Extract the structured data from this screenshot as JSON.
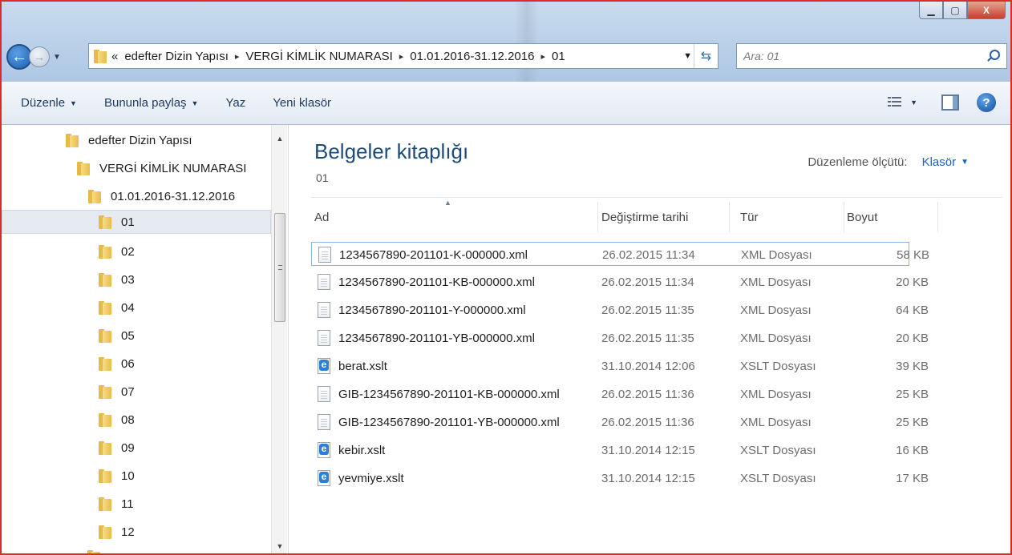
{
  "window": {
    "buttons": {
      "minimize": "▁",
      "maximize": "▢",
      "close": "X"
    }
  },
  "address_bar": {
    "crumbs": [
      "«",
      "edefter Dizin Yapısı",
      "VERGİ KİMLİK NUMARASI",
      "01.01.2016-31.12.2016",
      "01"
    ],
    "separator": "▸"
  },
  "search": {
    "placeholder": "Ara: 01"
  },
  "toolbar": {
    "organize": "Düzenle",
    "share": "Bununla paylaş",
    "burn": "Yaz",
    "new_folder": "Yeni klasör"
  },
  "nav_tree": {
    "items": [
      {
        "label": "edefter Dizin Yapısı",
        "level": 0
      },
      {
        "label": "VERGİ KİMLİK NUMARASI",
        "level": 1
      },
      {
        "label": "01.01.2016-31.12.2016",
        "level": 2
      },
      {
        "label": "01",
        "level": 3,
        "selected": true
      },
      {
        "label": "02",
        "level": 3
      },
      {
        "label": "03",
        "level": 3
      },
      {
        "label": "04",
        "level": 3
      },
      {
        "label": "05",
        "level": 3
      },
      {
        "label": "06",
        "level": 3
      },
      {
        "label": "07",
        "level": 3
      },
      {
        "label": "08",
        "level": 3
      },
      {
        "label": "09",
        "level": 3
      },
      {
        "label": "10",
        "level": 3
      },
      {
        "label": "11",
        "level": 3
      },
      {
        "label": "12",
        "level": 3
      }
    ]
  },
  "library": {
    "title": "Belgeler kitaplığı",
    "subtitle": "01",
    "arrange_label": "Düzenleme ölçütü:",
    "arrange_value": "Klasör"
  },
  "columns": {
    "name": "Ad",
    "date": "Değiştirme tarihi",
    "type": "Tür",
    "size": "Boyut"
  },
  "files": [
    {
      "name": "1234567890-201101-K-000000.xml",
      "date": "26.02.2015 11:34",
      "type": "XML Dosyası",
      "size": "58 KB",
      "icon": "xml-doc-icon",
      "selected": true
    },
    {
      "name": "1234567890-201101-KB-000000.xml",
      "date": "26.02.2015 11:34",
      "type": "XML Dosyası",
      "size": "20 KB",
      "icon": "xml-doc-icon"
    },
    {
      "name": "1234567890-201101-Y-000000.xml",
      "date": "26.02.2015 11:35",
      "type": "XML Dosyası",
      "size": "64 KB",
      "icon": "xml-doc-icon"
    },
    {
      "name": "1234567890-201101-YB-000000.xml",
      "date": "26.02.2015 11:35",
      "type": "XML Dosyası",
      "size": "20 KB",
      "icon": "xml-doc-icon"
    },
    {
      "name": "berat.xslt",
      "date": "31.10.2014 12:06",
      "type": "XSLT Dosyası",
      "size": "39 KB",
      "icon": "xslt-ie-icon"
    },
    {
      "name": "GIB-1234567890-201101-KB-000000.xml",
      "date": "26.02.2015 11:36",
      "type": "XML Dosyası",
      "size": "25 KB",
      "icon": "xml-doc-icon"
    },
    {
      "name": "GIB-1234567890-201101-YB-000000.xml",
      "date": "26.02.2015 11:36",
      "type": "XML Dosyası",
      "size": "25 KB",
      "icon": "xml-doc-icon"
    },
    {
      "name": "kebir.xslt",
      "date": "31.10.2014 12:15",
      "type": "XSLT Dosyası",
      "size": "16 KB",
      "icon": "xslt-ie-icon"
    },
    {
      "name": "yevmiye.xslt",
      "date": "31.10.2014 12:15",
      "type": "XSLT Dosyası",
      "size": "17 KB",
      "icon": "xslt-ie-icon"
    }
  ]
}
